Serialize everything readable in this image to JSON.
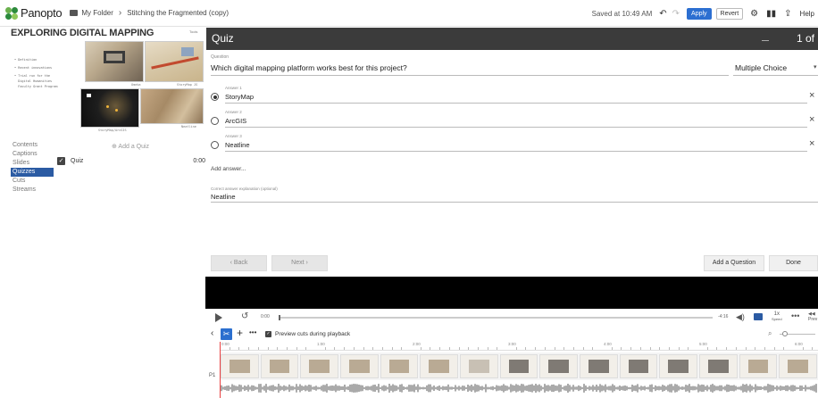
{
  "app": {
    "logo_text": "Panopto",
    "breadcrumb": [
      "My Folder",
      "Stitching the Fragmented (copy)"
    ]
  },
  "topbar": {
    "saved_text": "Saved at 10:49 AM",
    "apply_label": "Apply",
    "revert_label": "Revert",
    "help_label": "Help",
    "icons": [
      "undo-icon",
      "redo-icon",
      "gear-icon",
      "stats-icon",
      "share-icon"
    ]
  },
  "slide": {
    "title": "EXPLORING DIGITAL MAPPING",
    "tools_label": "Tools",
    "bullets": [
      "• Definition",
      "• Recent innovations",
      "• Trial run for the\n  Digital Humanities\n  Faculty Grant Program"
    ],
    "thumb_labels": [
      "Omeka",
      "StoryMap JS",
      "StoryMap/ArcGIS",
      "Neatline"
    ]
  },
  "sidebar": {
    "items": [
      {
        "label": "Contents",
        "active": false
      },
      {
        "label": "Captions",
        "active": false
      },
      {
        "label": "Slides",
        "active": false
      },
      {
        "label": "Quizzes",
        "active": true
      },
      {
        "label": "Cuts",
        "active": false
      },
      {
        "label": "Streams",
        "active": false
      }
    ],
    "add_quiz_label": "⊕ Add a Quiz",
    "quiz_item": {
      "label": "Quiz",
      "time": "0:00"
    }
  },
  "quiz": {
    "header_title": "Quiz",
    "page_indicator": "1 of",
    "question_label": "Question",
    "question_text": "Which digital mapping platform works best for this project?",
    "question_type": "Multiple Choice",
    "answers": [
      {
        "label": "Answer 1",
        "text": "StoryMap",
        "selected": true
      },
      {
        "label": "Answer 2",
        "text": "ArcGIS",
        "selected": false
      },
      {
        "label": "Answer 3",
        "text": "Neatline",
        "selected": false
      }
    ],
    "add_answer_label": "Add answer...",
    "explanation_label": "Correct answer explanation (optional)",
    "explanation_text": "Neatline",
    "back_label": "‹  Back",
    "next_label": "Next  ›",
    "add_question_label": "Add a Question",
    "done_label": "Done"
  },
  "player": {
    "time_start": "0:00",
    "time_end": "-4:16",
    "speed_value": "1x",
    "speed_label": "Speed",
    "prev_next_label": "◀◀\nPrev"
  },
  "editor": {
    "preview_label": "Preview cuts during playback",
    "track_label": "P1",
    "ruler_ticks": [
      "0:00",
      "1:00",
      "2:00",
      "3:00",
      "4:00",
      "5:00",
      "6:00"
    ],
    "frame_tones": [
      "l",
      "l",
      "l",
      "l",
      "l",
      "l",
      "w",
      "d",
      "d",
      "d",
      "d",
      "d",
      "d",
      "l",
      "l"
    ]
  },
  "colors": {
    "accent_blue": "#2c6fd1",
    "nav_active": "#2b5ba3",
    "header_dark": "#3b3b3b",
    "playhead": "#e94040"
  }
}
